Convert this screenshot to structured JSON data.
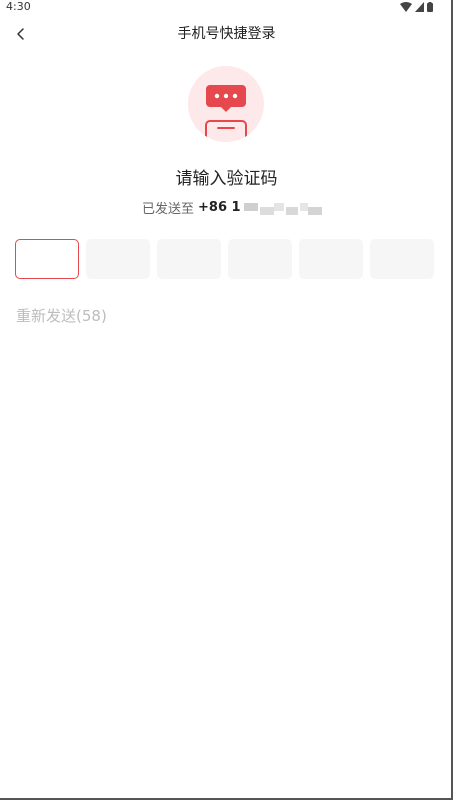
{
  "status": {
    "time": "4:30"
  },
  "nav": {
    "title": "手机号快捷登录",
    "back_icon": "chevron-left-icon"
  },
  "illustration": {
    "icon": "sms-phone-icon"
  },
  "heading": "请输入验证码",
  "sent": {
    "prefix": "已发送至",
    "phone_prefix": "+86 1"
  },
  "code_boxes": [
    "",
    "",
    "",
    "",
    "",
    ""
  ],
  "resend_label": "重新发送(58)",
  "colors": {
    "accent": "#e5484d",
    "box_bg": "#f6f6f6",
    "muted": "#bdbdbd"
  }
}
